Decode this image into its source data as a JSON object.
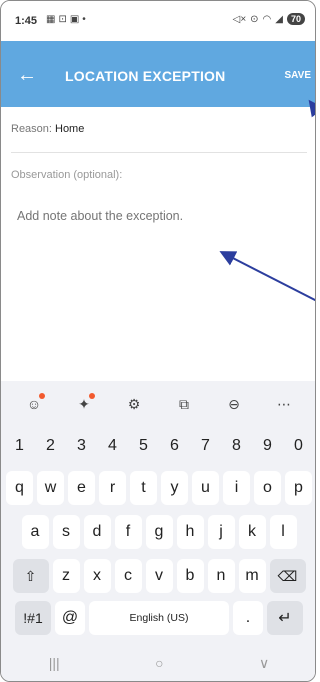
{
  "status_bar": {
    "time": "1:45",
    "left_icons": [
      "calendar-icon",
      "screenshot-icon",
      "calendar-31-icon",
      "dot-icon"
    ],
    "right_icons": [
      "mute-icon",
      "location-icon",
      "wifi-icon",
      "signal-icon"
    ],
    "battery": "70"
  },
  "app_bar": {
    "back_icon": "arrow-left-icon",
    "title": "LOCATION EXCEPTION",
    "save_label": "SAVE",
    "color": "#60a8e0"
  },
  "form": {
    "reason_label": "Reason:",
    "reason_value": "Home",
    "observation_label": "Observation (optional):",
    "note_placeholder": "Add note about the exception."
  },
  "keyboard": {
    "toolbar": [
      "emoji-icon",
      "sparkle-icon",
      "settings-icon",
      "translate-icon",
      "sticker-icon",
      "more-icon"
    ],
    "number_row": [
      "1",
      "2",
      "3",
      "4",
      "5",
      "6",
      "7",
      "8",
      "9",
      "0"
    ],
    "row1": [
      "q",
      "w",
      "e",
      "r",
      "t",
      "y",
      "u",
      "i",
      "o",
      "p"
    ],
    "row2": [
      "a",
      "s",
      "d",
      "f",
      "g",
      "h",
      "j",
      "k",
      "l"
    ],
    "row3": [
      "z",
      "x",
      "c",
      "v",
      "b",
      "n",
      "m"
    ],
    "symbols_key": "!#1",
    "at_key": "@",
    "space_label": "English (US)",
    "period_key": "."
  },
  "nav_bar": [
    "recents-icon",
    "home-icon",
    "back-chevron-icon"
  ],
  "annotation_color": "#2c3e9e"
}
